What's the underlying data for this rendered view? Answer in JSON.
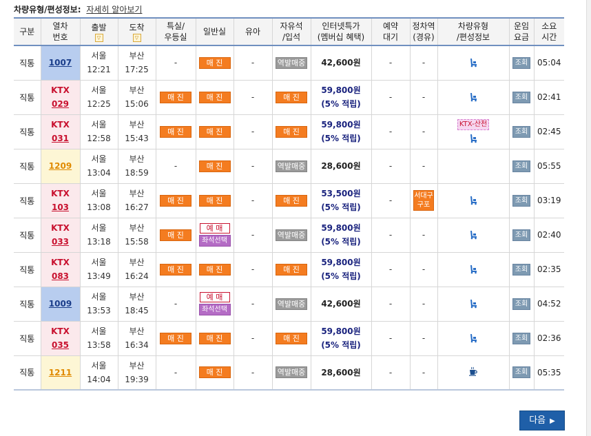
{
  "top": {
    "label": "차량유형/편성정보:",
    "link": "자세히 알아보기"
  },
  "headers": {
    "c1": "구분",
    "c2": "열차번호",
    "c3": "출발",
    "c4": "도착",
    "c5": "특실/우등실",
    "c6": "일반실",
    "c7": "유아",
    "c8": "자유석/입석",
    "c9": "인터넷특가(멤버십 혜택)",
    "c10": "예약대기",
    "c11": "정차역(경유)",
    "c12": "차량유형/편성정보",
    "c13": "운임요금",
    "c14": "소요시간",
    "c2a": "열차",
    "c2b": "번호",
    "c5a": "특실/",
    "c5b": "우등실",
    "c8a": "자유석",
    "c8b": "/입석",
    "c9a": "인터넷특가",
    "c9b": "(멤버십 혜택)",
    "c10a": "예약",
    "c10b": "대기",
    "c11a": "정차역",
    "c11b": "(경유)",
    "c12a": "차량유형",
    "c12b": "/편성정보",
    "c13a": "운임",
    "c13b": "요금",
    "c14a": "소요",
    "c14b": "시간",
    "sort_glyph": "▽"
  },
  "labels": {
    "sold_out": "매 진",
    "station_sale": "역발매중",
    "reserve": "예 매",
    "seat_select": "좌석선택",
    "view": "조회",
    "dash": "-",
    "ktx_sancheon": "KTX-산천",
    "direct": "직통",
    "next": "다음",
    "next_arrow": "▶"
  },
  "colors": {
    "header_border": "#6f8fbf",
    "sold_out": "#f47c20",
    "ktx_red": "#c8102e",
    "next_button": "#1f5fa8"
  },
  "rows": [
    {
      "type": "직통",
      "kind": "mugunghwa",
      "name": "",
      "no": "1007",
      "dep_st": "서울",
      "dep_t": "12:21",
      "arr_st": "부산",
      "arr_t": "17:25",
      "special": "-",
      "general": "sold_out",
      "infant": "-",
      "free": "station_sale",
      "price": "42,600원",
      "points": "",
      "wait": "-",
      "stop": "",
      "stop2": "-",
      "sancheon": false,
      "icon": "train-icon",
      "dur": "05:04"
    },
    {
      "type": "직통",
      "kind": "ktx",
      "name": "KTX",
      "no": "029",
      "dep_st": "서울",
      "dep_t": "12:25",
      "arr_st": "부산",
      "arr_t": "15:06",
      "special": "sold_out",
      "general": "sold_out",
      "infant": "-",
      "free": "sold_out",
      "price": "59,800원",
      "points": "(5% 적립)",
      "wait": "-",
      "stop": "",
      "stop2": "-",
      "sancheon": false,
      "icon": "train-icon",
      "dur": "02:41"
    },
    {
      "type": "직통",
      "kind": "ktx",
      "name": "KTX",
      "no": "031",
      "dep_st": "서울",
      "dep_t": "12:58",
      "arr_st": "부산",
      "arr_t": "15:43",
      "special": "sold_out",
      "general": "sold_out",
      "infant": "-",
      "free": "sold_out",
      "price": "59,800원",
      "points": "(5% 적립)",
      "wait": "-",
      "stop": "",
      "stop2": "-",
      "sancheon": true,
      "icon": "train-icon",
      "dur": "02:45"
    },
    {
      "type": "직통",
      "kind": "itx",
      "name": "",
      "no": "1209",
      "dep_st": "서울",
      "dep_t": "13:04",
      "arr_st": "부산",
      "arr_t": "18:59",
      "special": "-",
      "general": "sold_out",
      "infant": "-",
      "free": "station_sale",
      "price": "28,600원",
      "points": "",
      "wait": "-",
      "stop": "",
      "stop2": "-",
      "sancheon": false,
      "icon": "",
      "dur": "05:55"
    },
    {
      "type": "직통",
      "kind": "ktx",
      "name": "KTX",
      "no": "103",
      "dep_st": "서울",
      "dep_t": "13:08",
      "arr_st": "부산",
      "arr_t": "16:27",
      "special": "sold_out",
      "general": "sold_out",
      "infant": "-",
      "free": "sold_out",
      "price": "53,500원",
      "points": "(5% 적립)",
      "wait": "-",
      "stop": "서대구",
      "stop2": "구포",
      "sancheon": false,
      "icon": "train-icon",
      "dur": "03:19"
    },
    {
      "type": "직통",
      "kind": "ktx",
      "name": "KTX",
      "no": "033",
      "dep_st": "서울",
      "dep_t": "13:18",
      "arr_st": "부산",
      "arr_t": "15:58",
      "special": "sold_out",
      "general": "reserve",
      "infant": "-",
      "free": "station_sale",
      "price": "59,800원",
      "points": "(5% 적립)",
      "wait": "-",
      "stop": "",
      "stop2": "-",
      "sancheon": false,
      "icon": "train-icon",
      "dur": "02:40"
    },
    {
      "type": "직통",
      "kind": "ktx",
      "name": "KTX",
      "no": "083",
      "dep_st": "서울",
      "dep_t": "13:49",
      "arr_st": "부산",
      "arr_t": "16:24",
      "special": "sold_out",
      "general": "sold_out",
      "infant": "-",
      "free": "sold_out",
      "price": "59,800원",
      "points": "(5% 적립)",
      "wait": "-",
      "stop": "",
      "stop2": "-",
      "sancheon": false,
      "icon": "train-icon",
      "dur": "02:35"
    },
    {
      "type": "직통",
      "kind": "mugunghwa",
      "name": "",
      "no": "1009",
      "dep_st": "서울",
      "dep_t": "13:53",
      "arr_st": "부산",
      "arr_t": "18:45",
      "special": "-",
      "general": "reserve",
      "infant": "-",
      "free": "station_sale",
      "price": "42,600원",
      "points": "",
      "wait": "-",
      "stop": "",
      "stop2": "-",
      "sancheon": false,
      "icon": "train-icon",
      "dur": "04:52"
    },
    {
      "type": "직통",
      "kind": "ktx",
      "name": "KTX",
      "no": "035",
      "dep_st": "서울",
      "dep_t": "13:58",
      "arr_st": "부산",
      "arr_t": "16:34",
      "special": "sold_out",
      "general": "sold_out",
      "infant": "-",
      "free": "sold_out",
      "price": "59,800원",
      "points": "(5% 적립)",
      "wait": "-",
      "stop": "",
      "stop2": "-",
      "sancheon": false,
      "icon": "train-icon",
      "dur": "02:36"
    },
    {
      "type": "직통",
      "kind": "itx",
      "name": "",
      "no": "1211",
      "dep_st": "서울",
      "dep_t": "14:04",
      "arr_st": "부산",
      "arr_t": "19:39",
      "special": "-",
      "general": "sold_out",
      "infant": "-",
      "free": "station_sale",
      "price": "28,600원",
      "points": "",
      "wait": "-",
      "stop": "",
      "stop2": "-",
      "sancheon": false,
      "icon": "coffee-icon",
      "dur": "05:35"
    }
  ]
}
